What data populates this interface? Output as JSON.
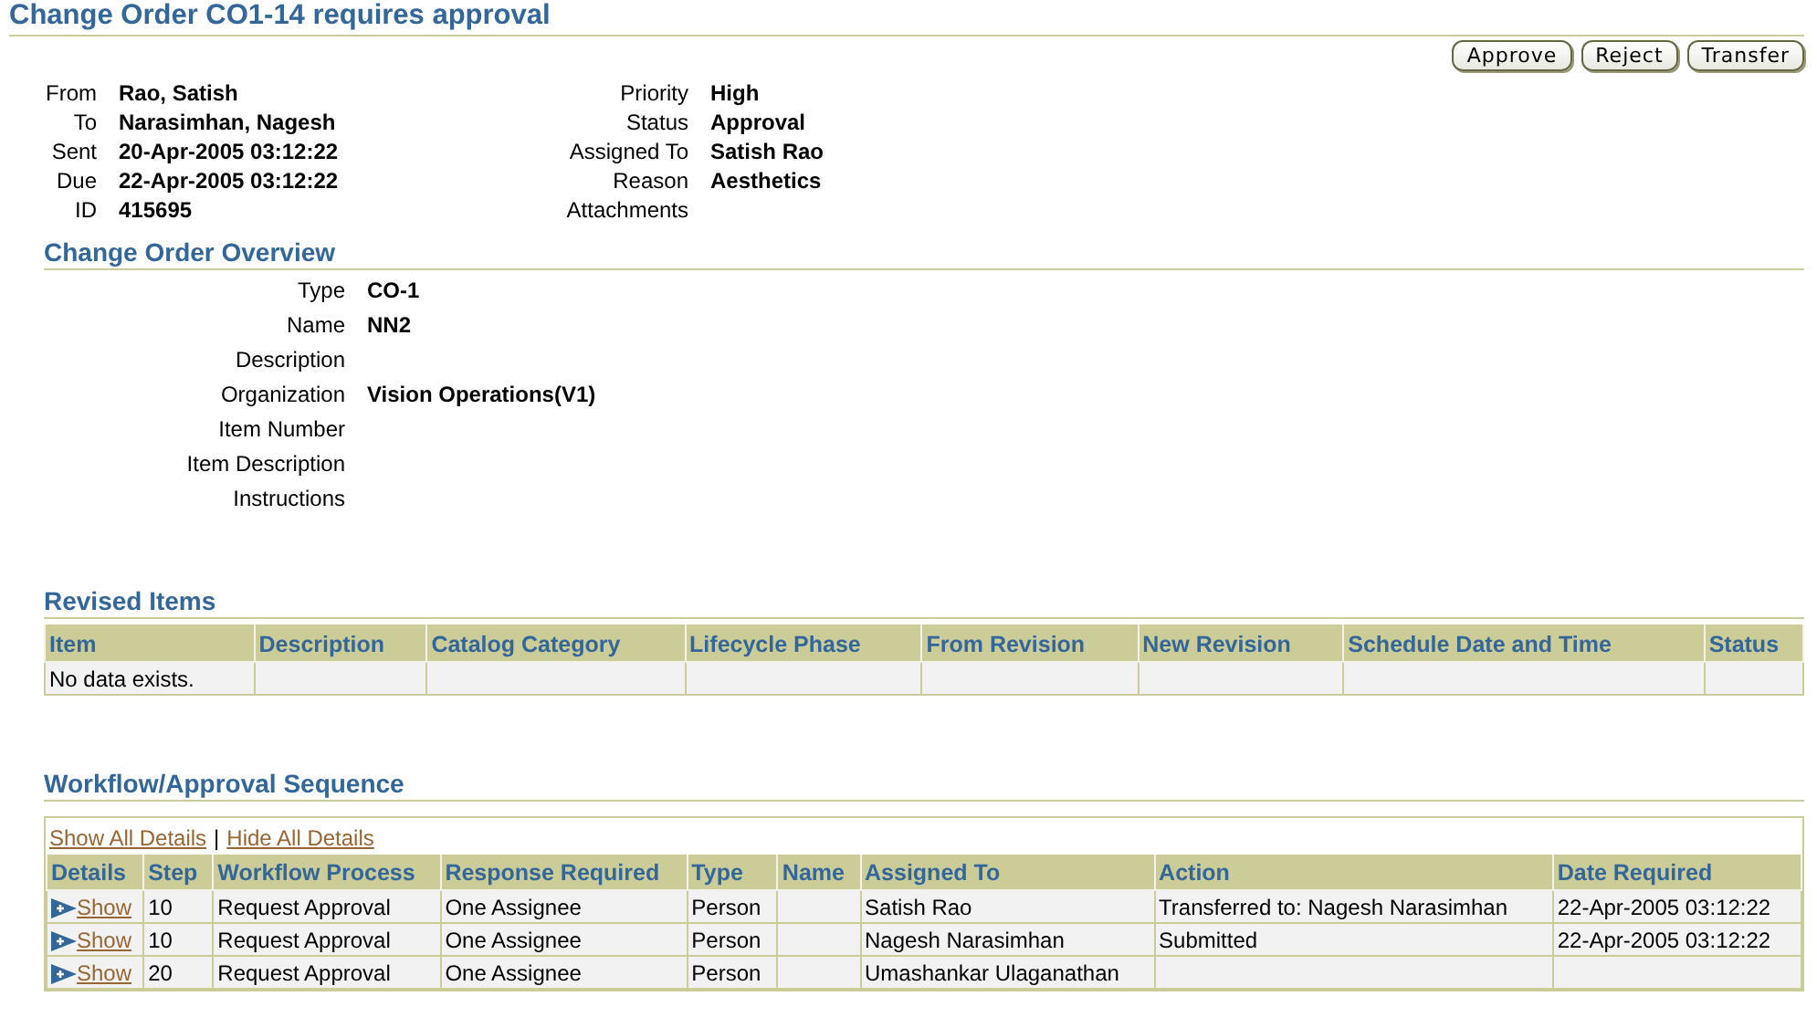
{
  "title": "Change Order CO1-14 requires approval",
  "buttons": [
    "Approve",
    "Reject",
    "Transfer"
  ],
  "header_left": [
    {
      "label": "From",
      "value": "Rao, Satish"
    },
    {
      "label": "To",
      "value": "Narasimhan, Nagesh"
    },
    {
      "label": "Sent",
      "value": "20-Apr-2005 03:12:22"
    },
    {
      "label": "Due",
      "value": "22-Apr-2005 03:12:22"
    },
    {
      "label": "ID",
      "value": "415695"
    }
  ],
  "header_right": [
    {
      "label": "Priority",
      "value": "High"
    },
    {
      "label": "Status",
      "value": "Approval"
    },
    {
      "label": "Assigned To",
      "value": "Satish Rao"
    },
    {
      "label": "Reason",
      "value": "Aesthetics"
    },
    {
      "label": "Attachments"
    }
  ],
  "overview": {
    "title": "Change Order Overview",
    "fields": [
      {
        "label": "Type",
        "value": "CO-1"
      },
      {
        "label": "Name",
        "value": "NN2"
      },
      {
        "label": "Description"
      },
      {
        "label": "Organization",
        "value": "Vision Operations(V1)"
      },
      {
        "label": "Item Number"
      },
      {
        "label": "Item Description"
      },
      {
        "label": "Instructions"
      }
    ]
  },
  "revised_items": {
    "title": "Revised Items",
    "columns": [
      "Item",
      "Description",
      "Catalog Category",
      "Lifecycle Phase",
      "From Revision",
      "New Revision",
      "Schedule Date and Time",
      "Status"
    ],
    "empty_message": "No data exists."
  },
  "workflow": {
    "title": "Workflow/Approval Sequence",
    "links": [
      "Show All Details",
      "Hide All Details"
    ],
    "link_separator": "|",
    "columns": [
      "Details",
      "Step",
      "Workflow Process",
      "Response Required",
      "Type",
      "Name",
      "Assigned To",
      "Action",
      "Date Required"
    ],
    "rows": [
      {
        "cells": [
          "Show",
          "10",
          "Request Approval",
          "One Assignee",
          "Person",
          "",
          "Satish Rao",
          "Transferred to: Nagesh Narasimhan",
          "22-Apr-2005 03:12:22"
        ]
      },
      {
        "cells": [
          "Show",
          "10",
          "Request Approval",
          "One Assignee",
          "Person",
          "",
          "Nagesh Narasimhan",
          "Submitted",
          "22-Apr-2005 03:12:22"
        ]
      },
      {
        "cells": [
          "Show",
          "20",
          "Request Approval",
          "One Assignee",
          "Person",
          "",
          "Umashankar Ulaganathan",
          "",
          ""
        ]
      }
    ]
  }
}
